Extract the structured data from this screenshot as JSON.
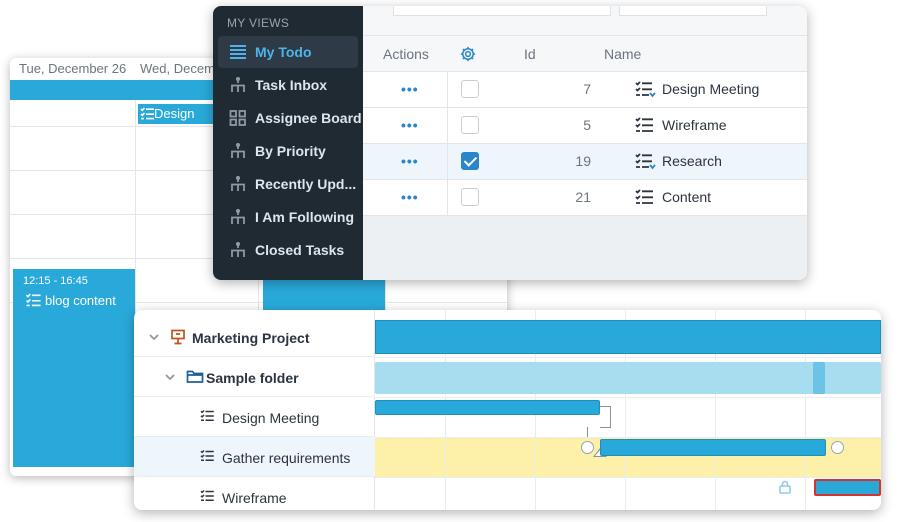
{
  "calendar": {
    "day_1": "Tue, December 26",
    "day_2": "Wed, Decem",
    "top_event_title": "Design",
    "event_time": "12:15 - 16:45",
    "event_title": "blog content"
  },
  "views_menu": {
    "title": "MY VIEWS",
    "items": [
      {
        "label": "My Todo",
        "icon": "list-icon",
        "active": true
      },
      {
        "label": "Task Inbox",
        "icon": "hierarchy-icon"
      },
      {
        "label": "Assignee Board",
        "icon": "board-grid-icon"
      },
      {
        "label": "By Priority",
        "icon": "hierarchy-icon"
      },
      {
        "label": "Recently Upd...",
        "icon": "hierarchy-icon"
      },
      {
        "label": "I Am Following",
        "icon": "hierarchy-icon"
      },
      {
        "label": "Closed Tasks",
        "icon": "hierarchy-icon"
      }
    ]
  },
  "task_grid": {
    "headers": {
      "actions": "Actions",
      "settings_icon": "gear-icon",
      "id": "Id",
      "name": "Name"
    },
    "rows": [
      {
        "actions": "•••",
        "checked": false,
        "id": "7",
        "name": "Design Meeting",
        "icon": "task-list-arrow-icon"
      },
      {
        "actions": "•••",
        "checked": false,
        "id": "5",
        "name": "Wireframe",
        "icon": "task-list-icon"
      },
      {
        "actions": "•••",
        "checked": true,
        "id": "19",
        "name": "Research",
        "icon": "task-list-arrow-icon"
      },
      {
        "actions": "•••",
        "checked": false,
        "id": "21",
        "name": "Content",
        "icon": "task-list-icon"
      }
    ]
  },
  "gantt": {
    "rows": [
      {
        "label": "Marketing Project",
        "icon": "project-icon",
        "expanded": true
      },
      {
        "label": "Sample folder",
        "icon": "folder-icon",
        "expanded": true
      },
      {
        "label": "Design Meeting",
        "icon": "task-list-icon"
      },
      {
        "label": "Gather requirements",
        "icon": "task-list-icon"
      },
      {
        "label": "Wireframe",
        "icon": "task-list-icon"
      }
    ]
  },
  "colors": {
    "accent_blue": "#29a9d9",
    "sidebar_bg": "#1f2a33",
    "active_link": "#4fb3ea",
    "highlight_yellow": "#fdf0a8",
    "critical_red": "#d0362f"
  }
}
